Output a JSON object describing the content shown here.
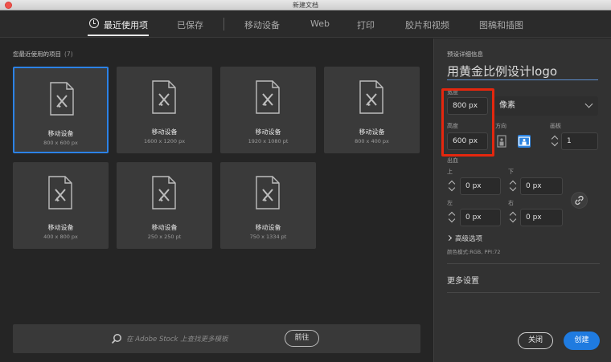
{
  "window": {
    "title": "新建文档"
  },
  "tabs": [
    {
      "label": "最近使用项",
      "active": true
    },
    {
      "label": "已保存"
    },
    {
      "label": "移动设备"
    },
    {
      "label": "Web"
    },
    {
      "label": "打印"
    },
    {
      "label": "胶片和视频"
    },
    {
      "label": "图稿和插图"
    }
  ],
  "recent": {
    "title": "您最近使用的项目",
    "count": "(7)",
    "items": [
      {
        "name": "移动设备",
        "size": "800 x 600 px",
        "selected": true
      },
      {
        "name": "移动设备",
        "size": "1600 x 1200 px"
      },
      {
        "name": "移动设备",
        "size": "1920 x 1080 pt"
      },
      {
        "name": "移动设备",
        "size": "800 x 400 px"
      },
      {
        "name": "移动设备",
        "size": "400 x 800 px"
      },
      {
        "name": "移动设备",
        "size": "250 x 250 pt"
      },
      {
        "name": "移动设备",
        "size": "750 x 1334 pt"
      }
    ]
  },
  "stock": {
    "placeholder": "在 Adobe Stock 上查找更多模板",
    "go_label": "前往"
  },
  "details": {
    "title": "预设详细信息",
    "preset_name": "用黄金比例设计logo",
    "width_label": "宽度",
    "width_value": "800 px",
    "unit": "像素",
    "height_label": "高度",
    "height_value": "600 px",
    "orientation_label": "方向",
    "artboards_label": "画板",
    "artboards_value": "1",
    "bleed_label": "出血",
    "top_label": "上",
    "top_value": "0 px",
    "bottom_label": "下",
    "bottom_value": "0 px",
    "left_label": "左",
    "left_value": "0 px",
    "right_label": "右",
    "right_value": "0 px",
    "advanced": "高级选项",
    "color_mode": "颜色模式:RGB, PPI:72",
    "more_settings": "更多设置"
  },
  "buttons": {
    "close": "关闭",
    "create": "创建"
  },
  "colors": {
    "accent": "#1f7be0",
    "highlight": "#e4270e",
    "background": "#252525"
  }
}
